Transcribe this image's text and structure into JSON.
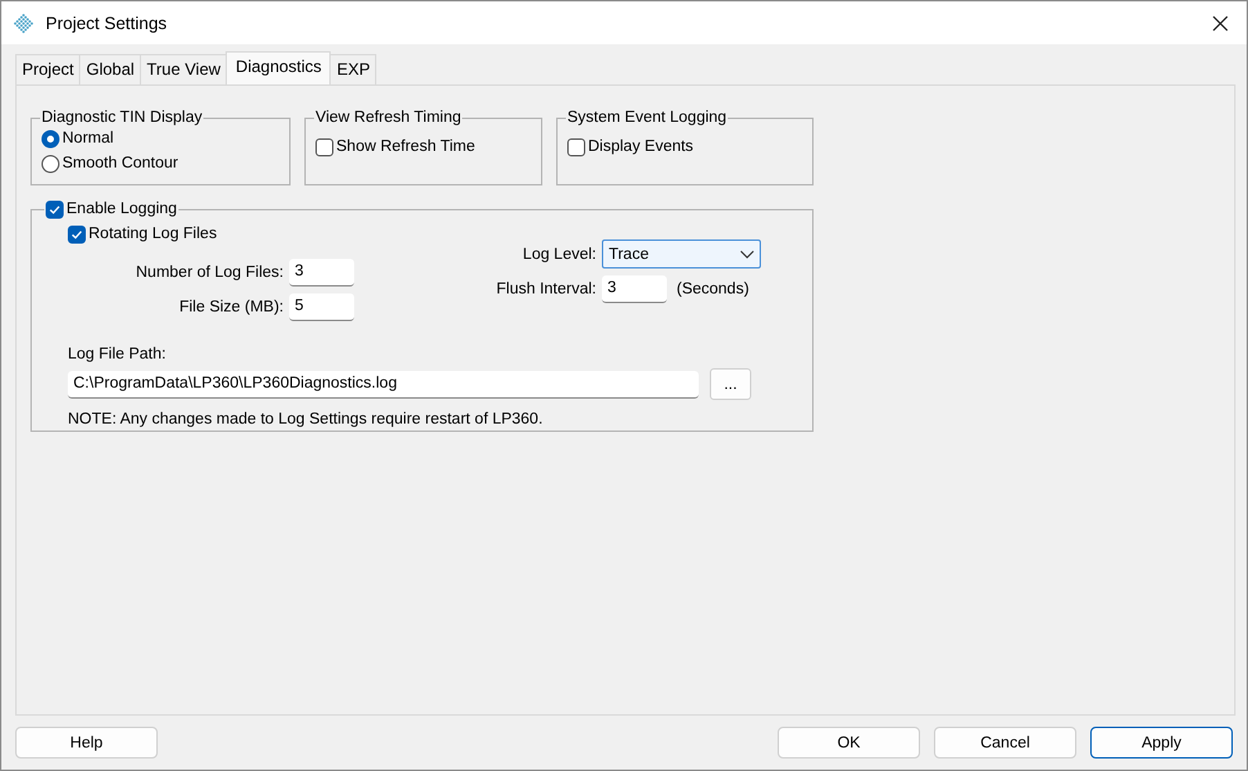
{
  "window": {
    "title": "Project Settings"
  },
  "tabs": [
    {
      "label": "Project",
      "selected": false
    },
    {
      "label": "Global",
      "selected": false
    },
    {
      "label": "True View",
      "selected": false
    },
    {
      "label": "Diagnostics",
      "selected": true
    },
    {
      "label": "EXP",
      "selected": false
    }
  ],
  "tin_display": {
    "title": "Diagnostic TIN Display",
    "options": [
      {
        "label": "Normal",
        "selected": true
      },
      {
        "label": "Smooth Contour",
        "selected": false
      }
    ]
  },
  "view_refresh": {
    "title": "View Refresh Timing",
    "checkbox": {
      "label": "Show Refresh Time",
      "checked": false
    }
  },
  "event_logging": {
    "title": "System Event Logging",
    "checkbox": {
      "label": "Display Events",
      "checked": false
    }
  },
  "logging": {
    "enable": {
      "label": "Enable Logging",
      "checked": true
    },
    "rotating": {
      "label": "Rotating Log Files",
      "checked": true
    },
    "number_of_log_files": {
      "label": "Number of Log Files:",
      "value": "3"
    },
    "file_size": {
      "label": "File Size (MB):",
      "value": "5"
    },
    "log_level": {
      "label": "Log Level:",
      "value": "Trace"
    },
    "flush_interval": {
      "label": "Flush Interval:",
      "value": "3",
      "unit": "(Seconds)"
    },
    "path": {
      "label": "Log File Path:",
      "value": "C:\\ProgramData\\LP360\\LP360Diagnostics.log",
      "browse": "..."
    },
    "note": "NOTE: Any changes made to Log Settings require restart of LP360."
  },
  "buttons": [
    {
      "label": "Help",
      "kind": "normal"
    },
    {
      "label": "OK",
      "kind": "normal"
    },
    {
      "label": "Cancel",
      "kind": "normal"
    },
    {
      "label": "Apply",
      "kind": "default"
    }
  ]
}
